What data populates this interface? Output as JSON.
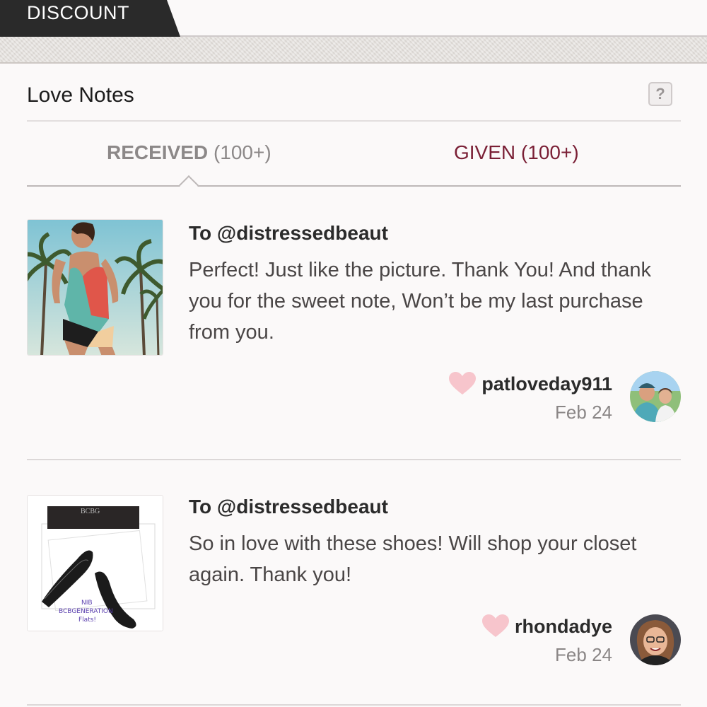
{
  "header": {
    "discount_tab": "DISCOUNT"
  },
  "section": {
    "title": "Love Notes",
    "help_label": "?"
  },
  "tabs": [
    {
      "label": "RECEIVED",
      "count": "(100+)",
      "active": true
    },
    {
      "label": "GIVEN",
      "count": "(100+)",
      "active": false
    }
  ],
  "notes": [
    {
      "to": "To @distressedbeaut",
      "message": "Perfect! Just like the picture. Thank You! And thank you for the sweet note, Won’t be my last purchase from you.",
      "username": "patloveday911",
      "date": "Feb 24",
      "thumbnail": "swimsuit-photo"
    },
    {
      "to": "To @distressedbeaut",
      "message": "So in love with these shoes! Will shop your closet again. Thank you!",
      "username": "rhondadye",
      "date": "Feb 24",
      "thumbnail": "shoes-photo",
      "thumbnail_caption": [
        "NIB",
        "BCBGENERATION",
        "Flats!"
      ],
      "box_brand": "BCBG"
    }
  ],
  "colors": {
    "accent": "#7a1f35",
    "heart": "#f7c5cc",
    "tab_dark": "#2a2a2a"
  }
}
